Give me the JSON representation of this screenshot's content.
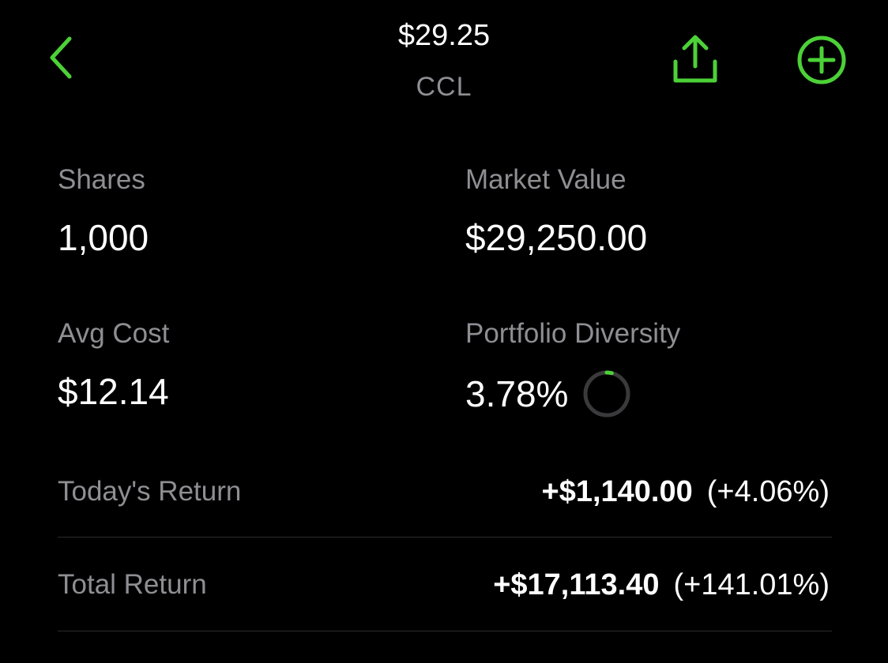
{
  "colors": {
    "accent": "#4cd137",
    "background": "#000000",
    "text_primary": "#ffffff",
    "text_secondary": "#8e8e93",
    "divider": "#2c2c2e",
    "ring_track": "#3a3a3c"
  },
  "header": {
    "back_icon": "chevron-left-icon",
    "price": "$29.25",
    "ticker": "CCL",
    "share_icon": "share-icon",
    "add_icon": "plus-circle-icon"
  },
  "stats": {
    "shares": {
      "label": "Shares",
      "value": "1,000"
    },
    "market_value": {
      "label": "Market Value",
      "value": "$29,250.00"
    },
    "avg_cost": {
      "label": "Avg Cost",
      "value": "$12.14"
    },
    "portfolio_diversity": {
      "label": "Portfolio Diversity",
      "value": "3.78%",
      "fraction": 0.0378
    }
  },
  "returns": {
    "today": {
      "label": "Today's Return",
      "amount": "+$1,140.00",
      "percent": "(+4.06%)"
    },
    "total": {
      "label": "Total Return",
      "amount": "+$17,113.40",
      "percent": "(+141.01%)"
    }
  }
}
